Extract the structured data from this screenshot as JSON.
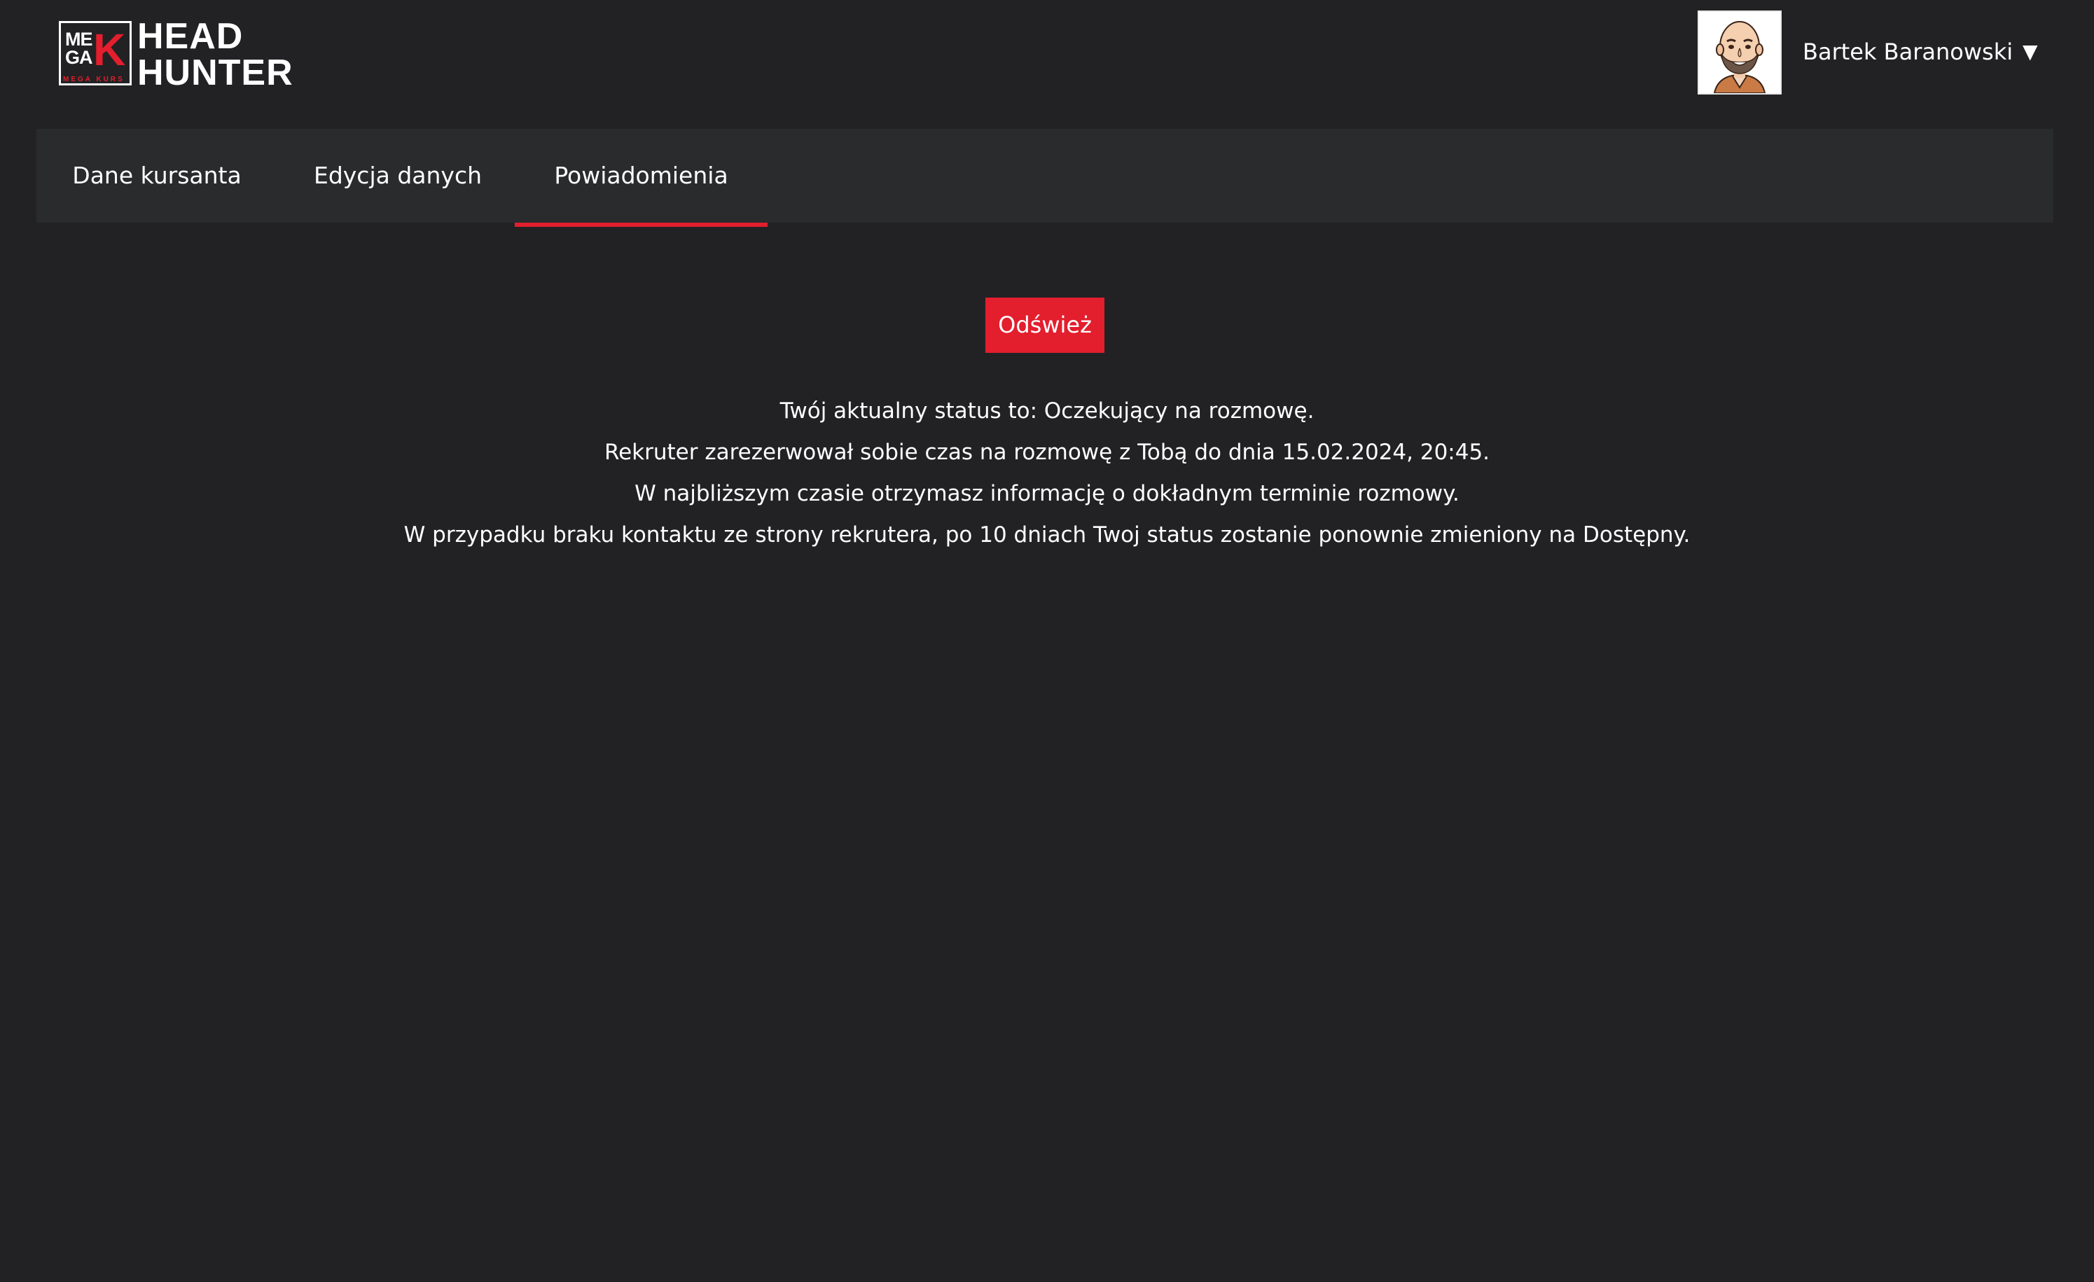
{
  "header": {
    "logo": {
      "badge_text_line1": "ME",
      "badge_text_line2": "GA",
      "badge_letter": "K",
      "subtitle": "MEGA KURS",
      "title_line1": "HEAD",
      "title_line2": "HUNTER"
    },
    "user": {
      "name": "Bartek Baranowski",
      "caret": "▼"
    }
  },
  "tabs": [
    {
      "label": "Dane kursanta",
      "active": false
    },
    {
      "label": "Edycja danych",
      "active": false
    },
    {
      "label": "Powiadomienia",
      "active": true
    }
  ],
  "main": {
    "refresh_label": "Odśwież",
    "messages": [
      "Twój aktualny status to: Oczekujący na rozmowę.",
      "Rekruter zarezerwował sobie czas na rozmowę z Tobą do dnia 15.02.2024, 20:45.",
      "W najbliższym czasie otrzymasz informację o dokładnym terminie rozmowy.",
      "W przypadku braku kontaktu ze strony rekrutera, po 10 dniach Twoj status zostanie ponownie zmieniony na Dostępny."
    ]
  },
  "colors": {
    "background": "#222224",
    "tab_bar": "#2a2b2d",
    "accent": "#e31e2d",
    "text": "#ffffff"
  },
  "icons": {
    "user_avatar": "user-avatar-icon",
    "dropdown": "chevron-down-icon"
  }
}
